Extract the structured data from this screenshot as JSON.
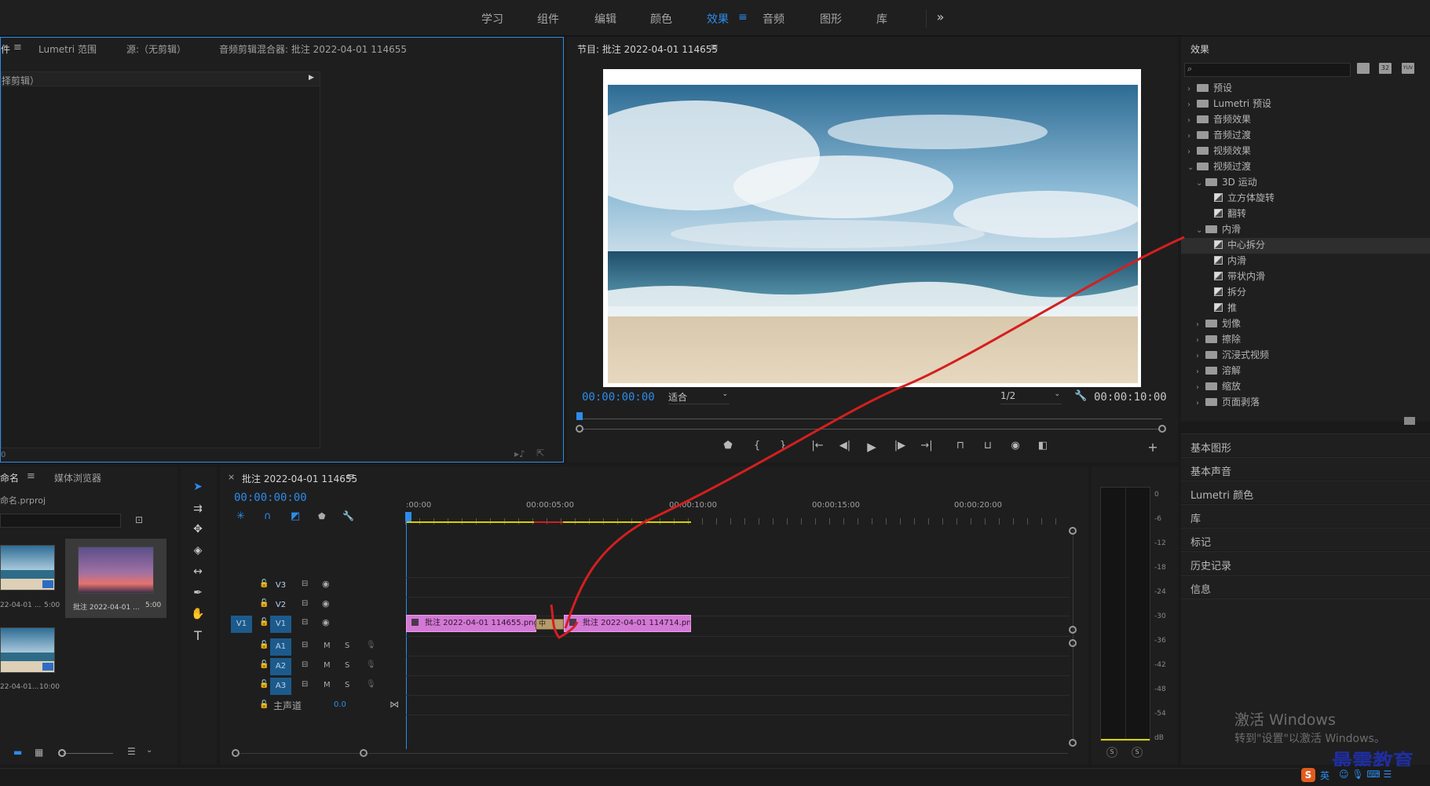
{
  "workspaces": {
    "items": [
      "学习",
      "组件",
      "编辑",
      "颜色",
      "效果",
      "音频",
      "图形",
      "库"
    ],
    "active": "效果",
    "more": "»"
  },
  "source_panel": {
    "tab_fragment": "件",
    "tabs": [
      "Lumetri 范围",
      "源:（无剪辑）",
      "音频剪辑混合器: 批注 2022-04-01 114655"
    ],
    "meta_header": "择剪辑）",
    "bottom_left": "0"
  },
  "program": {
    "title": "节目: 批注 2022-04-01 114655",
    "timecode_in": "00:00:00:00",
    "fit": "适合",
    "resolution": "1/2",
    "timecode_out": "00:00:10:00"
  },
  "effects": {
    "title": "效果",
    "search_placeholder": "",
    "filter_icons": [
      "32",
      "YUV"
    ],
    "tree": [
      {
        "label": "预设",
        "level": 0,
        "type": "folder-star",
        "open": false
      },
      {
        "label": "Lumetri 预设",
        "level": 0,
        "type": "folder-star",
        "open": false
      },
      {
        "label": "音频效果",
        "level": 0,
        "type": "folder",
        "open": false
      },
      {
        "label": "音频过渡",
        "level": 0,
        "type": "folder",
        "open": false
      },
      {
        "label": "视频效果",
        "level": 0,
        "type": "folder",
        "open": false
      },
      {
        "label": "视频过渡",
        "level": 0,
        "type": "folder",
        "open": true
      },
      {
        "label": "3D 运动",
        "level": 1,
        "type": "folder",
        "open": true
      },
      {
        "label": "立方体旋转",
        "level": 2,
        "type": "effect"
      },
      {
        "label": "翻转",
        "level": 2,
        "type": "effect"
      },
      {
        "label": "内滑",
        "level": 1,
        "type": "folder",
        "open": true
      },
      {
        "label": "中心拆分",
        "level": 2,
        "type": "effect",
        "selected": true
      },
      {
        "label": "内滑",
        "level": 2,
        "type": "effect"
      },
      {
        "label": "带状内滑",
        "level": 2,
        "type": "effect"
      },
      {
        "label": "拆分",
        "level": 2,
        "type": "effect"
      },
      {
        "label": "推",
        "level": 2,
        "type": "effect"
      },
      {
        "label": "划像",
        "level": 1,
        "type": "folder",
        "open": false
      },
      {
        "label": "擦除",
        "level": 1,
        "type": "folder",
        "open": false
      },
      {
        "label": "沉浸式视频",
        "level": 1,
        "type": "folder",
        "open": false
      },
      {
        "label": "溶解",
        "level": 1,
        "type": "folder",
        "open": false
      },
      {
        "label": "缩放",
        "level": 1,
        "type": "folder",
        "open": false
      },
      {
        "label": "页面剥落",
        "level": 1,
        "type": "folder",
        "open": false
      }
    ]
  },
  "side_panels": [
    "基本图形",
    "基本声音",
    "Lumetri 颜色",
    "库",
    "标记",
    "历史记录",
    "信息"
  ],
  "project": {
    "tabs": [
      "命名",
      "媒体浏览器"
    ],
    "file": "命名.prproj",
    "items": [
      {
        "name": "22-04-01 ...",
        "duration": "5:00"
      },
      {
        "name": "批注 2022-04-01 ...",
        "duration": "5:00"
      },
      {
        "name": "22-04-01...",
        "duration": "10:00"
      }
    ]
  },
  "timeline": {
    "close": "×",
    "title": "批注 2022-04-01 114655",
    "timecode": "00:00:00:00",
    "ruler": [
      ":00:00",
      "00:00:05:00",
      "00:00:10:00",
      "00:00:15:00",
      "00:00:20:00"
    ],
    "video_tracks": [
      "V3",
      "V2",
      "V1"
    ],
    "audio_tracks": [
      "A1",
      "A2",
      "A3"
    ],
    "source_patch": "V1",
    "master": {
      "label": "主声道",
      "value": "0.0"
    },
    "track_buttons": {
      "mute": "M",
      "solo": "S"
    },
    "clips": [
      {
        "label": "批注 2022-04-01  114655.png"
      },
      {
        "label": "批注 2022-04-01  114714.png"
      }
    ],
    "transition_label": "中"
  },
  "meter": {
    "scale": [
      "0",
      "-6",
      "-12",
      "-18",
      "-24",
      "-30",
      "-36",
      "-42",
      "-48",
      "-54",
      "dB"
    ],
    "solo": [
      "S",
      "S"
    ]
  },
  "watermark": {
    "line1": "激活 Windows",
    "line2": "转到\"设置\"以激活 Windows。"
  },
  "brand": "最需教育",
  "ime": "英"
}
